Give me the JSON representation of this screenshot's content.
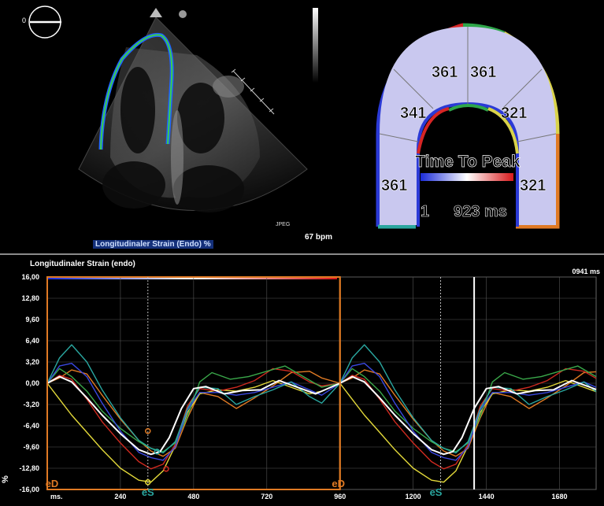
{
  "echo": {
    "depth_marker": "0",
    "format": "JPEG",
    "heart_rate": "67 bpm",
    "strain_label": "Longitudinaler Strain (Endo) %"
  },
  "bullseye": {
    "title": "Time To Peak",
    "segments": [
      "341",
      "361",
      "361",
      "321",
      "361",
      "321"
    ],
    "scale_min": "1",
    "scale_max": "923 ms"
  },
  "chart_data": {
    "type": "line",
    "title": "Longitudinaler Strain (endo)",
    "time_readout": "0941 ms",
    "ylabel": "%",
    "xlabel": "ms.",
    "ylim": [
      -16.0,
      16.0
    ],
    "xlim": [
      0,
      1800
    ],
    "yticks": [
      "16,00",
      "12,80",
      "9,60",
      "6,40",
      "3,20",
      "0,00",
      "-3,20",
      "-6,40",
      "-9,60",
      "-12,80",
      "-16,00"
    ],
    "ytick_values": [
      16,
      12.8,
      9.6,
      6.4,
      3.2,
      0,
      -3.2,
      -6.4,
      -9.6,
      -12.8,
      -16
    ],
    "xticks": [
      "ms.",
      "240",
      "480",
      "720",
      "960",
      "1200",
      "1440",
      "1680"
    ],
    "xtick_values": [
      0,
      240,
      480,
      720,
      960,
      1200,
      1440,
      1680
    ],
    "markers": {
      "eD1": 0,
      "eS1": 330,
      "eD2": 960,
      "eS2": 1290,
      "cursor": 1400
    },
    "marker_labels": {
      "eD": "eD",
      "eS": "eS"
    },
    "colors": {
      "white": "#ffffff",
      "teal": "#2aa7a0",
      "green": "#3aa84a",
      "yellow": "#e3d93a",
      "red": "#d02a20",
      "orange": "#e07a24",
      "blue": "#3a48e0"
    },
    "series": [
      {
        "color": "white",
        "x": [
          0,
          40,
          80,
          130,
          180,
          240,
          300,
          340,
          370,
          400,
          440,
          480,
          520,
          580,
          640,
          700,
          760,
          820,
          880,
          960
        ],
        "y": [
          0,
          1.0,
          0.2,
          -2.2,
          -4.8,
          -7.6,
          -10.0,
          -10.7,
          -10.3,
          -8.2,
          -3.8,
          -0.8,
          -0.5,
          -1.6,
          -1.1,
          -1.0,
          0.4,
          -0.6,
          -1.6,
          0
        ]
      },
      {
        "color": "teal",
        "x": [
          0,
          40,
          80,
          130,
          180,
          240,
          300,
          340,
          380,
          420,
          460,
          500,
          560,
          620,
          680,
          740,
          800,
          860,
          900,
          960
        ],
        "y": [
          0,
          3.8,
          5.8,
          3.2,
          -1.0,
          -5.2,
          -8.6,
          -9.8,
          -10.5,
          -8.8,
          -3.8,
          -0.6,
          -0.8,
          -3.2,
          -2.0,
          -1.0,
          0.2,
          -2.0,
          -3.0,
          0
        ]
      },
      {
        "color": "green",
        "x": [
          0,
          40,
          80,
          130,
          180,
          240,
          300,
          340,
          380,
          420,
          460,
          500,
          540,
          600,
          660,
          720,
          780,
          840,
          900,
          960
        ],
        "y": [
          0,
          2.2,
          1.0,
          -1.2,
          -4.2,
          -6.8,
          -8.8,
          -9.8,
          -10.3,
          -9.0,
          -5.0,
          0.2,
          1.6,
          0.6,
          1.0,
          1.8,
          2.6,
          1.0,
          -0.6,
          0
        ]
      },
      {
        "color": "yellow",
        "x": [
          0,
          40,
          80,
          130,
          180,
          240,
          300,
          340,
          380,
          420,
          460,
          500,
          560,
          620,
          680,
          740,
          800,
          860,
          900,
          960
        ],
        "y": [
          0,
          -2.4,
          -4.8,
          -7.4,
          -10.0,
          -12.8,
          -14.6,
          -14.9,
          -13.2,
          -9.4,
          -4.4,
          -1.6,
          -1.0,
          -1.2,
          -0.6,
          0.4,
          -0.6,
          -1.6,
          -1.2,
          0
        ]
      },
      {
        "color": "red",
        "x": [
          0,
          40,
          80,
          130,
          180,
          240,
          300,
          340,
          380,
          420,
          460,
          500,
          560,
          620,
          680,
          740,
          800,
          860,
          900,
          960
        ],
        "y": [
          0,
          1.2,
          0.6,
          -2.4,
          -5.8,
          -9.0,
          -11.8,
          -12.9,
          -12.2,
          -9.2,
          -3.4,
          -0.8,
          -1.2,
          -0.6,
          0.4,
          2.2,
          1.8,
          0.2,
          -0.4,
          0
        ]
      },
      {
        "color": "orange",
        "x": [
          0,
          40,
          80,
          130,
          180,
          240,
          300,
          340,
          380,
          420,
          460,
          500,
          560,
          620,
          680,
          740,
          800,
          860,
          900,
          960
        ],
        "y": [
          0,
          0.8,
          2.0,
          1.4,
          -1.8,
          -5.4,
          -8.6,
          -10.2,
          -11.0,
          -9.8,
          -5.2,
          -1.4,
          -2.0,
          -3.8,
          -2.2,
          -0.4,
          1.6,
          1.8,
          0.8,
          0
        ]
      },
      {
        "color": "blue",
        "x": [
          0,
          40,
          80,
          130,
          180,
          240,
          300,
          340,
          380,
          420,
          460,
          500,
          560,
          620,
          680,
          740,
          800,
          860,
          900,
          960
        ],
        "y": [
          0,
          2.6,
          3.0,
          1.0,
          -3.0,
          -7.2,
          -10.4,
          -11.2,
          -11.6,
          -9.6,
          -4.0,
          -1.4,
          -1.4,
          -1.8,
          -1.4,
          -0.6,
          0.2,
          -1.0,
          -1.8,
          0
        ]
      }
    ]
  }
}
